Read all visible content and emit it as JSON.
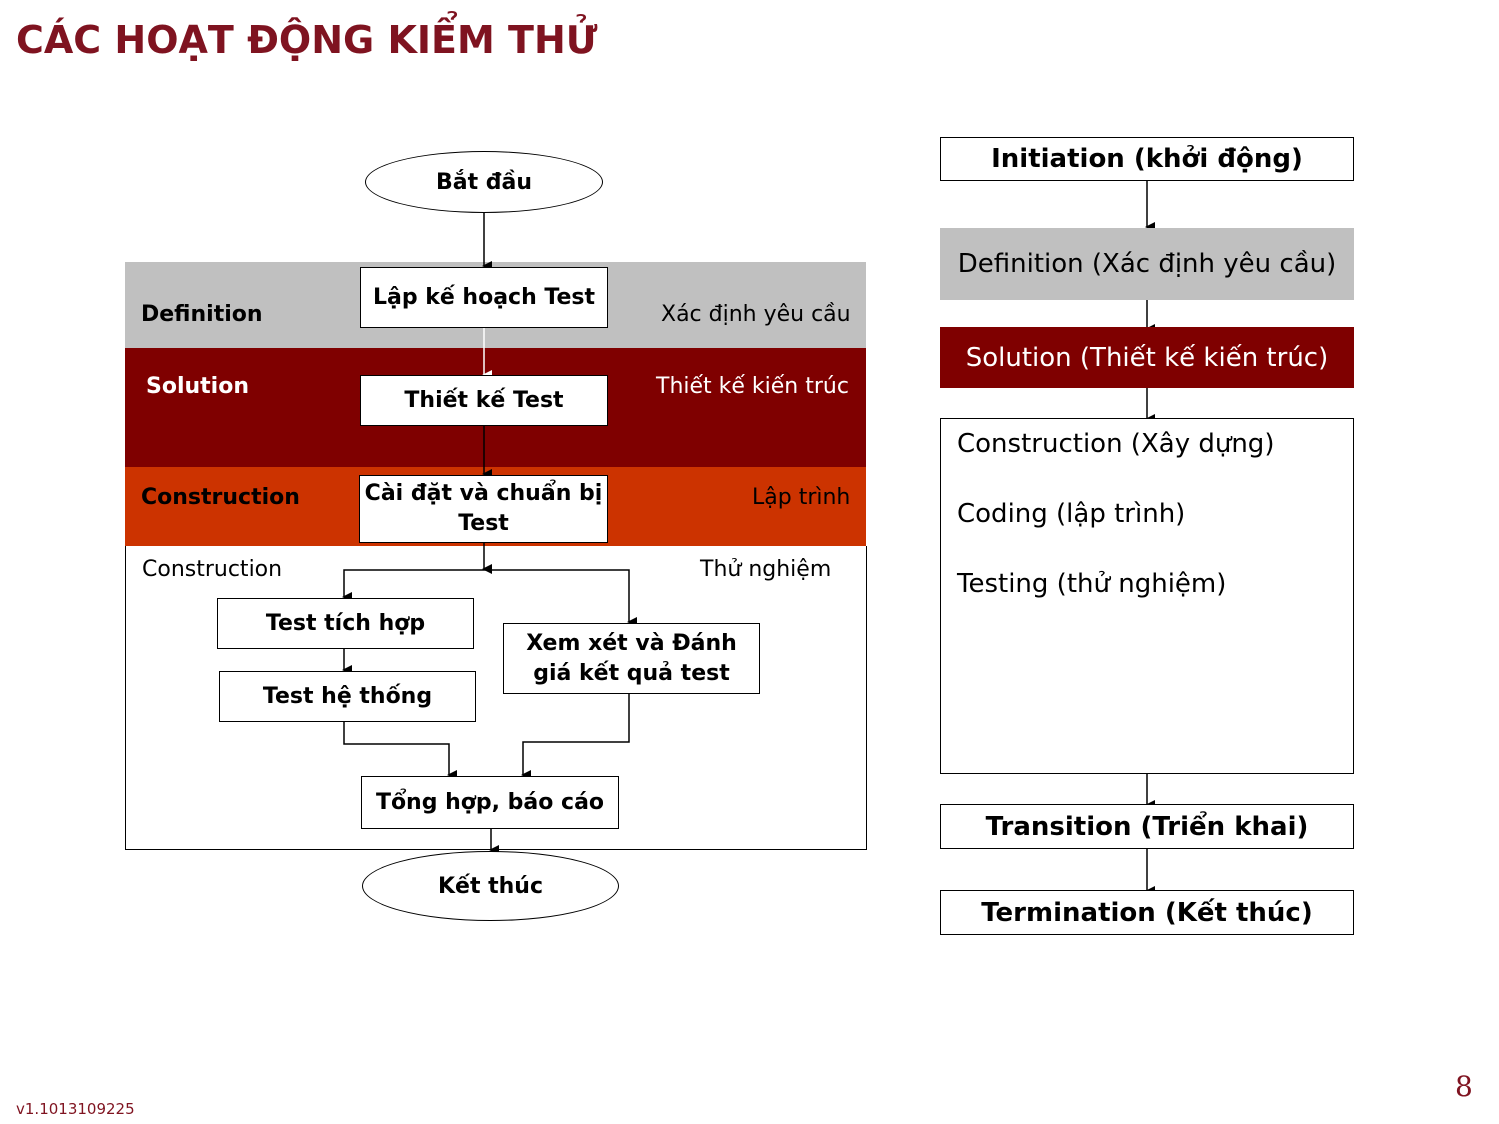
{
  "slide": {
    "title": "CÁC HOẠT ĐỘNG KIỂM THỬ",
    "version": "v1.1013109225",
    "page_number": "8"
  },
  "colors": {
    "title": "#7f1320",
    "definition_band": "#c0c0c0",
    "solution_band": "#7f0000",
    "construction_band": "#cc3300"
  },
  "flowchart": {
    "start": "Bắt đầu",
    "end": "Kết thúc",
    "bands": {
      "definition": {
        "left_label": "Definition",
        "right_label": "Xác định yêu cầu"
      },
      "solution": {
        "left_label": "Solution",
        "right_label": "Thiết kế kiến trúc"
      },
      "construction": {
        "left_label": "Construction",
        "right_label": "Lập trình"
      },
      "testing": {
        "left_label": "Construction",
        "right_label": "Thử  nghiệm"
      }
    },
    "steps": {
      "plan": "Lập kế hoạch Test",
      "design": "Thiết kế Test",
      "setup_line1": "Cài đặt và chuẩn bị",
      "setup_line2": "Test",
      "integration": "Test tích hợp",
      "system": "Test hệ thống",
      "review_line1": "Xem xét và Đánh",
      "review_line2": "giá  kết quả test",
      "report": "Tổng hợp, báo cáo"
    }
  },
  "lifecycle": {
    "initiation": "Initiation (khởi động)",
    "definition": "Definition (Xác định yêu cầu)",
    "solution": "Solution (Thiết kế kiến trúc)",
    "construction_items": [
      "Construction (Xây dựng)",
      "Coding (lập trình)",
      "Testing (thử  nghiệm)"
    ],
    "transition": "Transition (Triển khai)",
    "termination": "Termination (Kết thúc)"
  }
}
